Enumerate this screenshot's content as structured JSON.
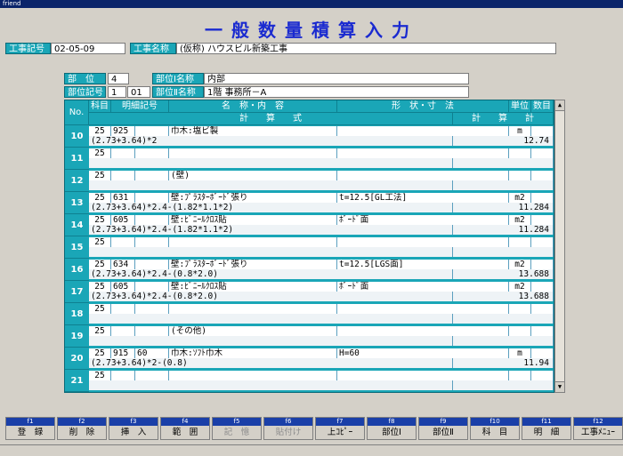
{
  "window_title": "friend",
  "screen_title": "一般数量積算入力",
  "header": {
    "kouji_no_label": "工事記号",
    "kouji_no_value": "02-05-09",
    "kouji_name_label": "工事名称",
    "kouji_name_value": "(仮称) ハウスビル新築工事"
  },
  "section": {
    "bui_label": "部　位",
    "bui_value": "4",
    "bui1_name_label": "部位Ⅰ名称",
    "bui1_name_value": "内部",
    "bui_code_label": "部位記号",
    "bui_code_1": "1",
    "bui_code_2": "01",
    "bui2_name_label": "部位Ⅱ名称",
    "bui2_name_value": "1階 事務所－A"
  },
  "grid": {
    "headers_top": [
      "科目",
      "明細記号",
      "名　称・内　容",
      "形　状・寸　法",
      "単位",
      "数目"
    ],
    "headers_bottom": [
      "計　　算　　式",
      "計　　算　　計"
    ],
    "no_label": "No."
  },
  "rows": [
    {
      "no": "10",
      "c1": "25",
      "c2": "925",
      "c3": "",
      "name": "巾木:塩ビ製",
      "shape": "",
      "unit": "m",
      "formula": "(2.73+3.64)*2",
      "total": "12.74"
    },
    {
      "no": "11",
      "c1": "25",
      "c2": "",
      "c3": "",
      "name": "",
      "shape": "",
      "unit": "",
      "formula": "",
      "total": ""
    },
    {
      "no": "12",
      "c1": "25",
      "c2": "",
      "c3": "",
      "name": "(壁)",
      "shape": "",
      "unit": "",
      "formula": "",
      "total": ""
    },
    {
      "no": "13",
      "c1": "25",
      "c2": "631",
      "c3": "",
      "name": "壁:ﾌﾟﾗｽﾀｰﾎﾞｰﾄﾞ張り",
      "shape": "t=12.5[GL工法]",
      "unit": "m2",
      "formula": "(2.73+3.64)*2.4-(1.82*1.1*2)",
      "total": "11.284"
    },
    {
      "no": "14",
      "c1": "25",
      "c2": "605",
      "c3": "",
      "name": "壁:ﾋﾞﾆｰﾙｸﾛｽ貼",
      "shape": "ﾎﾞｰﾄﾞ面",
      "unit": "m2",
      "formula": "(2.73+3.64)*2.4-(1.82*1.1*2)",
      "total": "11.284"
    },
    {
      "no": "15",
      "c1": "25",
      "c2": "",
      "c3": "",
      "name": "",
      "shape": "",
      "unit": "",
      "formula": "",
      "total": ""
    },
    {
      "no": "16",
      "c1": "25",
      "c2": "634",
      "c3": "",
      "name": "壁:ﾌﾟﾗｽﾀｰﾎﾞｰﾄﾞ張り",
      "shape": "t=12.5[LGS面]",
      "unit": "m2",
      "formula": "(2.73+3.64)*2.4-(0.8*2.0)",
      "total": "13.688"
    },
    {
      "no": "17",
      "c1": "25",
      "c2": "605",
      "c3": "",
      "name": "壁:ﾋﾞﾆｰﾙｸﾛｽ貼",
      "shape": "ﾎﾞｰﾄﾞ面",
      "unit": "m2",
      "formula": "(2.73+3.64)*2.4-(0.8*2.0)",
      "total": "13.688"
    },
    {
      "no": "18",
      "c1": "25",
      "c2": "",
      "c3": "",
      "name": "",
      "shape": "",
      "unit": "",
      "formula": "",
      "total": ""
    },
    {
      "no": "19",
      "c1": "25",
      "c2": "",
      "c3": "",
      "name": "(その他)",
      "shape": "",
      "unit": "",
      "formula": "",
      "total": ""
    },
    {
      "no": "20",
      "c1": "25",
      "c2": "915",
      "c3": "60",
      "name": "巾木:ｿﾌﾄ巾木",
      "shape": "H=60",
      "unit": "m",
      "formula": "(2.73+3.64)*2-(0.8)",
      "total": "11.94"
    },
    {
      "no": "21",
      "c1": "25",
      "c2": "",
      "c3": "",
      "name": "",
      "shape": "",
      "unit": "",
      "formula": "",
      "total": ""
    }
  ],
  "fkeys": [
    {
      "fn": "f1",
      "label": "登　録",
      "disabled": false
    },
    {
      "fn": "f2",
      "label": "削　除",
      "disabled": false
    },
    {
      "fn": "f3",
      "label": "挿　入",
      "disabled": false
    },
    {
      "fn": "f4",
      "label": "範　囲",
      "disabled": false
    },
    {
      "fn": "f5",
      "label": "記　憶",
      "disabled": true
    },
    {
      "fn": "f6",
      "label": "貼付け",
      "disabled": true
    },
    {
      "fn": "f7",
      "label": "上ｺﾋﾟｰ",
      "disabled": false
    },
    {
      "fn": "f8",
      "label": "部位Ⅰ",
      "disabled": false
    },
    {
      "fn": "f9",
      "label": "部位Ⅱ",
      "disabled": false
    },
    {
      "fn": "f10",
      "label": "科　目",
      "disabled": false
    },
    {
      "fn": "f11",
      "label": "明　細",
      "disabled": false
    },
    {
      "fn": "f12",
      "label": "工事ﾒﾆｭｰ",
      "disabled": false
    }
  ]
}
